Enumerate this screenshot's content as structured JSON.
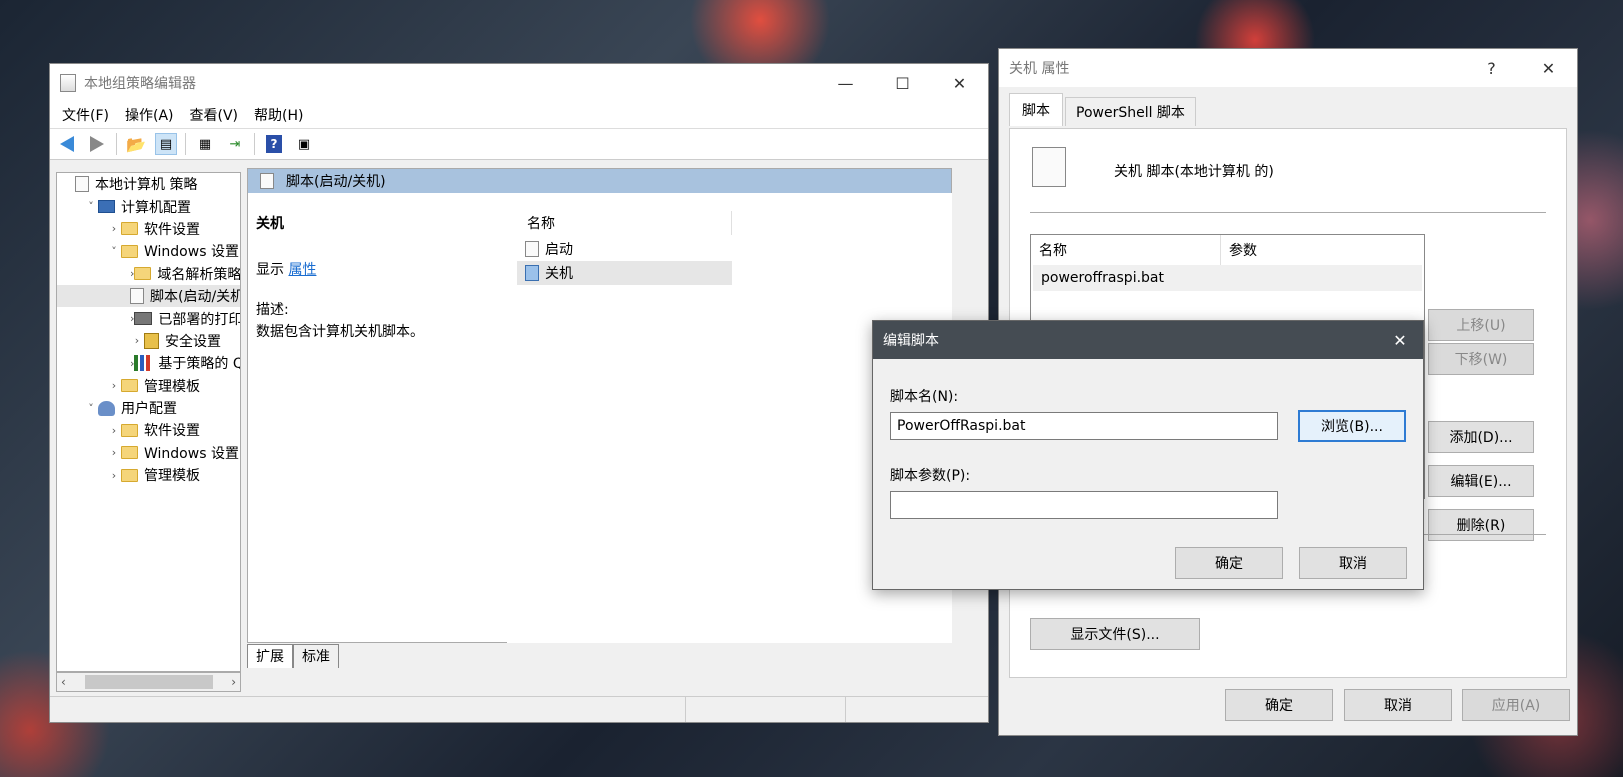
{
  "gpedit": {
    "title": "本地组策略编辑器",
    "menu": [
      "文件(F)",
      "操作(A)",
      "查看(V)",
      "帮助(H)"
    ],
    "tree": [
      {
        "label": "本地计算机 策略",
        "indent": 0,
        "chev": "",
        "icon": "doc-icon"
      },
      {
        "label": "计算机配置",
        "indent": 1,
        "chev": "˅",
        "icon": "computer-icon"
      },
      {
        "label": "软件设置",
        "indent": 2,
        "chev": "›",
        "icon": "folder-icon"
      },
      {
        "label": "Windows 设置",
        "indent": 2,
        "chev": "˅",
        "icon": "folder-icon"
      },
      {
        "label": "域名解析策略",
        "indent": 3,
        "chev": "›",
        "icon": "folder-icon"
      },
      {
        "label": "脚本(启动/关机)",
        "indent": 3,
        "chev": "",
        "icon": "script-icon",
        "selected": true
      },
      {
        "label": "已部署的打印机",
        "indent": 3,
        "chev": "›",
        "icon": "printer-icon"
      },
      {
        "label": "安全设置",
        "indent": 3,
        "chev": "›",
        "icon": "security-icon"
      },
      {
        "label": "基于策略的 QoS",
        "indent": 3,
        "chev": "›",
        "icon": "chart-icon"
      },
      {
        "label": "管理模板",
        "indent": 2,
        "chev": "›",
        "icon": "folder-icon"
      },
      {
        "label": "用户配置",
        "indent": 1,
        "chev": "˅",
        "icon": "user-icon"
      },
      {
        "label": "软件设置",
        "indent": 2,
        "chev": "›",
        "icon": "folder-icon"
      },
      {
        "label": "Windows 设置",
        "indent": 2,
        "chev": "›",
        "icon": "folder-icon"
      },
      {
        "label": "管理模板",
        "indent": 2,
        "chev": "›",
        "icon": "folder-icon"
      }
    ],
    "detail_header": "脚本(启动/关机)",
    "ext_title": "关机",
    "show_label": "显示",
    "show_link": "属性",
    "desc_label": "描述:",
    "desc_text": "数据包含计算机关机脚本。",
    "list_header": "名称",
    "list_items": [
      "启动",
      "关机"
    ],
    "bottom_tabs": [
      "扩展",
      "标准"
    ]
  },
  "props": {
    "title": "关机 属性",
    "help": "?",
    "tabs": [
      "脚本",
      "PowerShell 脚本"
    ],
    "heading": "关机 脚本(本地计算机 的)",
    "col_name": "名称",
    "col_params": "参数",
    "rows": [
      "poweroffraspi.bat"
    ],
    "btn_up": "上移(U)",
    "btn_down": "下移(W)",
    "btn_add": "添加(D)...",
    "btn_edit": "编辑(E)...",
    "btn_delete": "删除(R)",
    "btn_show_files": "显示文件(S)...",
    "btn_ok": "确定",
    "btn_cancel": "取消",
    "btn_apply": "应用(A)"
  },
  "edit": {
    "title": "编辑脚本",
    "name_label": "脚本名(N):",
    "name_value": "PowerOffRaspi.bat",
    "params_label": "脚本参数(P):",
    "params_value": "",
    "btn_browse": "浏览(B)...",
    "btn_ok": "确定",
    "btn_cancel": "取消"
  }
}
